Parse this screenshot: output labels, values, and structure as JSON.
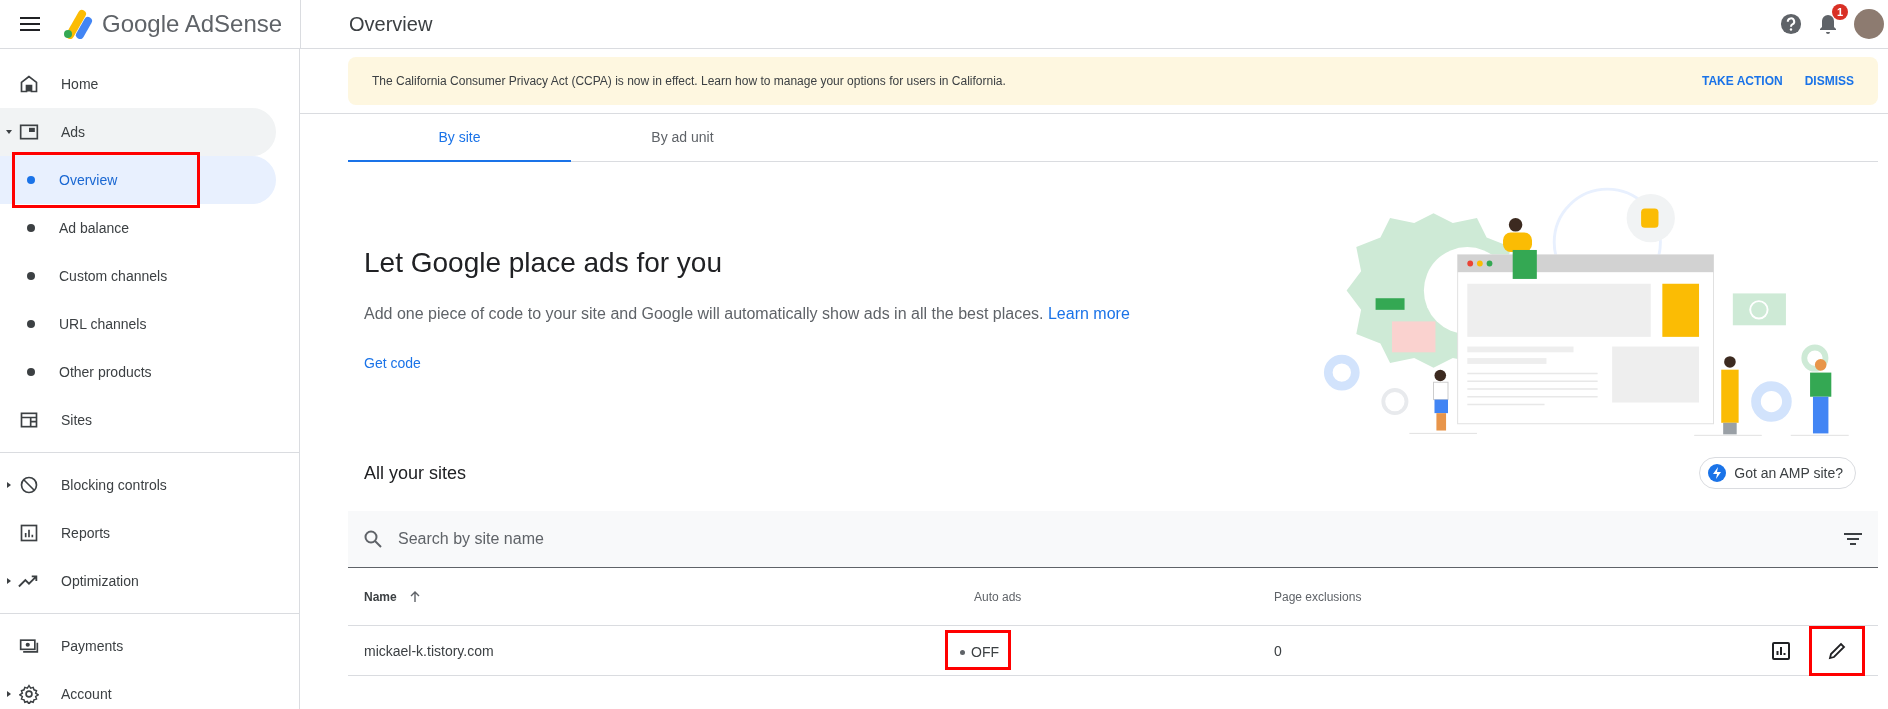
{
  "header": {
    "product": "Google AdSense",
    "page_title": "Overview",
    "notification_count": "1"
  },
  "sidebar": {
    "sections": [
      [
        {
          "label": "Home",
          "kind": "link",
          "selected": false
        },
        {
          "label": "Ads",
          "kind": "group",
          "expanded": true,
          "selected": true,
          "children": [
            {
              "label": "Overview",
              "selected": true,
              "highlighted": true
            },
            {
              "label": "Ad balance",
              "selected": false,
              "highlighted": false
            },
            {
              "label": "Custom channels",
              "selected": false,
              "highlighted": false
            },
            {
              "label": "URL channels",
              "selected": false,
              "highlighted": false
            },
            {
              "label": "Other products",
              "selected": false,
              "highlighted": false
            }
          ]
        },
        {
          "label": "Sites",
          "kind": "link",
          "selected": false
        }
      ],
      [
        {
          "label": "Blocking controls",
          "kind": "group",
          "expanded": false,
          "selected": false
        },
        {
          "label": "Reports",
          "kind": "link",
          "selected": false
        },
        {
          "label": "Optimization",
          "kind": "group",
          "expanded": false,
          "selected": false
        }
      ],
      [
        {
          "label": "Payments",
          "kind": "link",
          "selected": false
        },
        {
          "label": "Account",
          "kind": "group",
          "expanded": false,
          "selected": false
        }
      ]
    ]
  },
  "banner": {
    "message": "The California Consumer Privacy Act (CCPA) is now in effect. Learn how to manage your options for users in California.",
    "actions": [
      "TAKE ACTION",
      "DISMISS"
    ]
  },
  "tabs": [
    {
      "label": "By site",
      "selected": true
    },
    {
      "label": "By ad unit",
      "selected": false
    }
  ],
  "hero": {
    "title": "Let Google place ads for you",
    "description": "Add one piece of code to your site and Google will automatically show ads in all the best places.",
    "link": "Learn more",
    "action": "Get code"
  },
  "sites": {
    "title": "All your sites",
    "amp_button": "Got an AMP site?",
    "search": {
      "placeholder": "Search by site name"
    },
    "columns": [
      {
        "label": "Name",
        "sorted": true
      },
      {
        "label": "Auto ads",
        "sorted": false
      },
      {
        "label": "Page exclusions",
        "sorted": false
      }
    ],
    "rows": [
      {
        "name": "mickael-k.tistory.com",
        "auto_ads": {
          "text": "OFF",
          "on": false,
          "highlighted": true
        },
        "page_exclusions": "0",
        "edit_highlighted": true
      }
    ]
  }
}
